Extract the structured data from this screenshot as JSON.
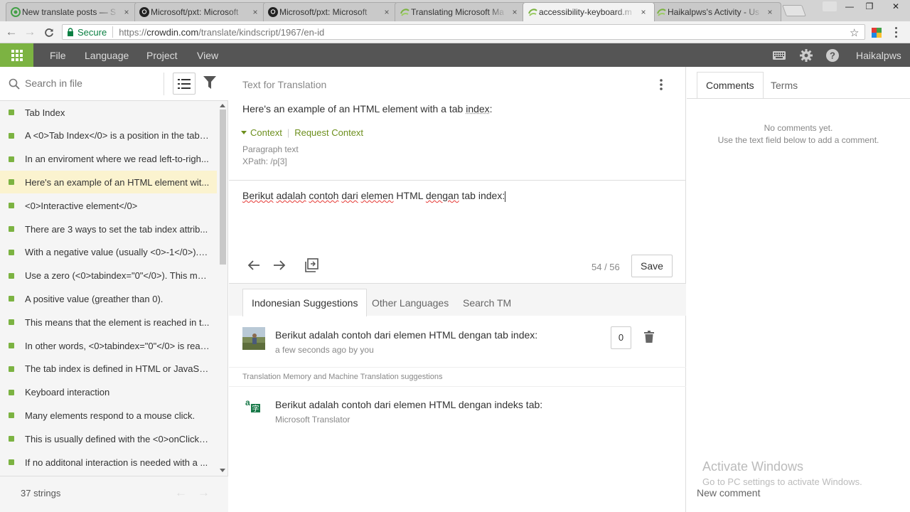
{
  "browser": {
    "tabs": [
      {
        "title": "New translate posts — S",
        "favicon": "green-swirl-icon",
        "active": false
      },
      {
        "title": "Microsoft/pxt: Microsoft",
        "favicon": "github-icon",
        "active": false
      },
      {
        "title": "Microsoft/pxt: Microsoft",
        "favicon": "github-icon",
        "active": false
      },
      {
        "title": "Translating Microsoft Ma",
        "favicon": "crowdin-icon",
        "active": false
      },
      {
        "title": "accessibility-keyboard.m",
        "favicon": "crowdin-icon",
        "active": true
      },
      {
        "title": "Haikalpws's Activity - Us",
        "favicon": "crowdin-icon",
        "active": false
      }
    ],
    "tab_close": "×",
    "secure_label": "Secure",
    "url_scheme": "https://",
    "url_host": "crowdin.com",
    "url_path": "/translate/kindscript/1967/en-id"
  },
  "header": {
    "menu": [
      "File",
      "Language",
      "Project",
      "View"
    ],
    "username": "Haikalpws"
  },
  "left": {
    "search_placeholder": "Search in file",
    "strings": [
      {
        "text": "Tab Index",
        "active": false
      },
      {
        "text": "A <0>Tab Index</0> is a position in the tabb...",
        "active": false
      },
      {
        "text": "In an enviroment where we read left-to-righ...",
        "active": false
      },
      {
        "text": "Here's an example of an HTML element wit...",
        "active": true
      },
      {
        "text": "<0>Interactive element</0>",
        "active": false
      },
      {
        "text": "There are 3 ways to set the tab index attrib...",
        "active": false
      },
      {
        "text": "With a negative value (usually <0>-1</0>). T...",
        "active": false
      },
      {
        "text": "Use a zero (<0>tabindex=\"0\"</0>). This mea...",
        "active": false
      },
      {
        "text": "A positive value (greather than 0).",
        "active": false
      },
      {
        "text": "This means that the element is reached in t...",
        "active": false
      },
      {
        "text": "In other words, <0>tabindex=\"0\"</0> is reac...",
        "active": false
      },
      {
        "text": "The tab index is defined in HTML or JavaScri...",
        "active": false
      },
      {
        "text": "Keyboard interaction",
        "active": false
      },
      {
        "text": "Many elements respond to a mouse click.",
        "active": false
      },
      {
        "text": "This is usually defined with the <0>onClick<...",
        "active": false
      },
      {
        "text": "If no additonal interaction is needed with a ...",
        "active": false
      }
    ],
    "string_count": "37 strings"
  },
  "center": {
    "label": "Text for Translation",
    "source_before": "Here's an example of an HTML element with a tab ",
    "source_underlined": "index",
    "source_after": ":",
    "context_label": "Context",
    "request_context": "Request Context",
    "context_type": "Paragraph text",
    "context_xpath": "XPath: /p[3]",
    "translation_words": [
      {
        "w": "Berikut",
        "spell": true
      },
      {
        "w": "adalah",
        "spell": true
      },
      {
        "w": "contoh",
        "spell": true
      },
      {
        "w": "dari",
        "spell": true
      },
      {
        "w": "elemen",
        "spell": true
      },
      {
        "w": "HTML",
        "spell": false
      },
      {
        "w": "dengan",
        "spell": true
      },
      {
        "w": "tab",
        "spell": false
      },
      {
        "w": "index:",
        "spell": false
      }
    ],
    "counter": "54 / 56",
    "save_label": "Save",
    "suggestion_tabs": [
      {
        "label": "Indonesian Suggestions",
        "active": true
      },
      {
        "label": "Other Languages",
        "active": false
      },
      {
        "label": "Search TM",
        "active": false
      }
    ],
    "suggestion": {
      "text": "Berikut adalah contoh dari elemen HTML dengan tab index:",
      "meta": "a few seconds ago by you",
      "votes": "0"
    },
    "tm_label": "Translation Memory and Machine Translation suggestions",
    "mt": {
      "text": "Berikut adalah contoh dari elemen HTML dengan indeks tab:",
      "source": "Microsoft Translator"
    }
  },
  "right": {
    "tabs": [
      {
        "label": "Comments",
        "active": true
      },
      {
        "label": "Terms",
        "active": false
      }
    ],
    "no_comments_1": "No comments yet.",
    "no_comments_2": "Use the text field below to add a comment.",
    "watermark_1": "Activate Windows",
    "watermark_2": "Go to PC settings to activate Windows.",
    "new_comment": "New comment"
  },
  "colors": {
    "brand_green": "#7cb342",
    "context_green": "#6d8f1d",
    "header_bg": "#555555",
    "active_row": "#fbf3cf"
  }
}
